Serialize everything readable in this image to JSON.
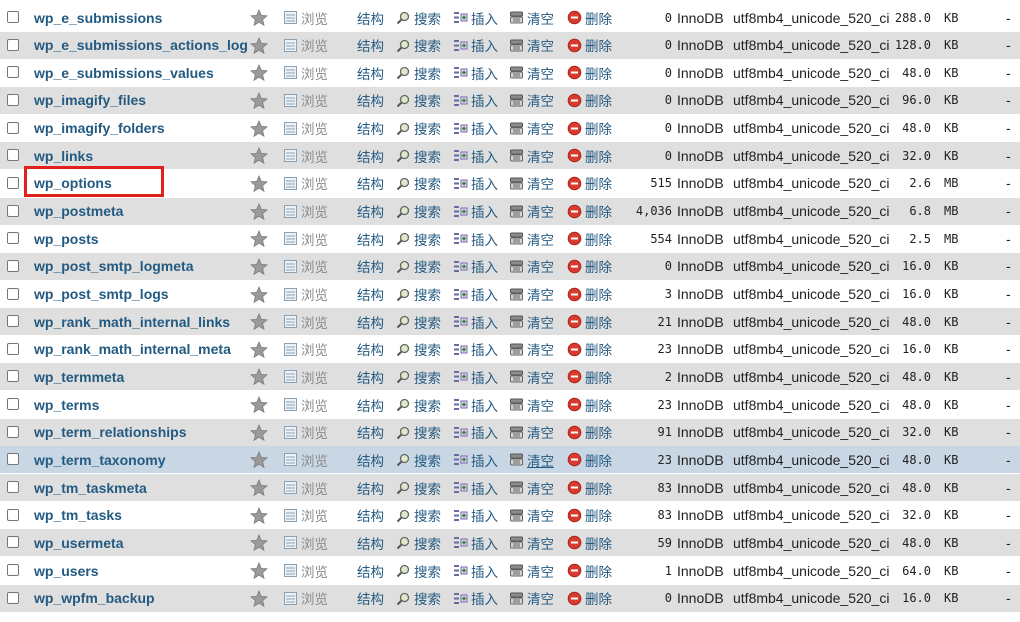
{
  "actions": {
    "browse": "浏览",
    "structure": "结构",
    "search": "搜索",
    "insert": "插入",
    "empty": "清空",
    "drop": "删除"
  },
  "icons": {
    "favorite": "star-icon",
    "browse": "browse-icon",
    "search": "search-icon",
    "insert": "insert-icon",
    "empty": "empty-icon",
    "drop": "drop-icon"
  },
  "colors": {
    "link": "#235a81",
    "row_alt": "#dfdfdf",
    "row_hover": "#c9d6e3",
    "highlight": "#e0201b",
    "star": "#9a9a9a",
    "drop": "#d83b2d"
  },
  "highlighted_table": "wp_options",
  "hovered_table": "wp_term_taxonomy",
  "tables": [
    {
      "name": "wp_e_submissions",
      "rows": "0",
      "engine": "InnoDB",
      "collation": "utf8mb4_unicode_520_ci",
      "size": "288.0",
      "unit": "KB",
      "overhead": "-"
    },
    {
      "name": "wp_e_submissions_actions_log",
      "rows": "0",
      "engine": "InnoDB",
      "collation": "utf8mb4_unicode_520_ci",
      "size": "128.0",
      "unit": "KB",
      "overhead": "-"
    },
    {
      "name": "wp_e_submissions_values",
      "rows": "0",
      "engine": "InnoDB",
      "collation": "utf8mb4_unicode_520_ci",
      "size": "48.0",
      "unit": "KB",
      "overhead": "-"
    },
    {
      "name": "wp_imagify_files",
      "rows": "0",
      "engine": "InnoDB",
      "collation": "utf8mb4_unicode_520_ci",
      "size": "96.0",
      "unit": "KB",
      "overhead": "-"
    },
    {
      "name": "wp_imagify_folders",
      "rows": "0",
      "engine": "InnoDB",
      "collation": "utf8mb4_unicode_520_ci",
      "size": "48.0",
      "unit": "KB",
      "overhead": "-"
    },
    {
      "name": "wp_links",
      "rows": "0",
      "engine": "InnoDB",
      "collation": "utf8mb4_unicode_520_ci",
      "size": "32.0",
      "unit": "KB",
      "overhead": "-"
    },
    {
      "name": "wp_options",
      "rows": "515",
      "engine": "InnoDB",
      "collation": "utf8mb4_unicode_520_ci",
      "size": "2.6",
      "unit": "MB",
      "overhead": "-"
    },
    {
      "name": "wp_postmeta",
      "rows": "4,036",
      "engine": "InnoDB",
      "collation": "utf8mb4_unicode_520_ci",
      "size": "6.8",
      "unit": "MB",
      "overhead": "-"
    },
    {
      "name": "wp_posts",
      "rows": "554",
      "engine": "InnoDB",
      "collation": "utf8mb4_unicode_520_ci",
      "size": "2.5",
      "unit": "MB",
      "overhead": "-"
    },
    {
      "name": "wp_post_smtp_logmeta",
      "rows": "0",
      "engine": "InnoDB",
      "collation": "utf8mb4_unicode_520_ci",
      "size": "16.0",
      "unit": "KB",
      "overhead": "-"
    },
    {
      "name": "wp_post_smtp_logs",
      "rows": "3",
      "engine": "InnoDB",
      "collation": "utf8mb4_unicode_520_ci",
      "size": "16.0",
      "unit": "KB",
      "overhead": "-"
    },
    {
      "name": "wp_rank_math_internal_links",
      "rows": "21",
      "engine": "InnoDB",
      "collation": "utf8mb4_unicode_520_ci",
      "size": "48.0",
      "unit": "KB",
      "overhead": "-"
    },
    {
      "name": "wp_rank_math_internal_meta",
      "rows": "23",
      "engine": "InnoDB",
      "collation": "utf8mb4_unicode_520_ci",
      "size": "16.0",
      "unit": "KB",
      "overhead": "-"
    },
    {
      "name": "wp_termmeta",
      "rows": "2",
      "engine": "InnoDB",
      "collation": "utf8mb4_unicode_520_ci",
      "size": "48.0",
      "unit": "KB",
      "overhead": "-"
    },
    {
      "name": "wp_terms",
      "rows": "23",
      "engine": "InnoDB",
      "collation": "utf8mb4_unicode_520_ci",
      "size": "48.0",
      "unit": "KB",
      "overhead": "-"
    },
    {
      "name": "wp_term_relationships",
      "rows": "91",
      "engine": "InnoDB",
      "collation": "utf8mb4_unicode_520_ci",
      "size": "32.0",
      "unit": "KB",
      "overhead": "-"
    },
    {
      "name": "wp_term_taxonomy",
      "rows": "23",
      "engine": "InnoDB",
      "collation": "utf8mb4_unicode_520_ci",
      "size": "48.0",
      "unit": "KB",
      "overhead": "-"
    },
    {
      "name": "wp_tm_taskmeta",
      "rows": "83",
      "engine": "InnoDB",
      "collation": "utf8mb4_unicode_520_ci",
      "size": "48.0",
      "unit": "KB",
      "overhead": "-"
    },
    {
      "name": "wp_tm_tasks",
      "rows": "83",
      "engine": "InnoDB",
      "collation": "utf8mb4_unicode_520_ci",
      "size": "32.0",
      "unit": "KB",
      "overhead": "-"
    },
    {
      "name": "wp_usermeta",
      "rows": "59",
      "engine": "InnoDB",
      "collation": "utf8mb4_unicode_520_ci",
      "size": "48.0",
      "unit": "KB",
      "overhead": "-"
    },
    {
      "name": "wp_users",
      "rows": "1",
      "engine": "InnoDB",
      "collation": "utf8mb4_unicode_520_ci",
      "size": "64.0",
      "unit": "KB",
      "overhead": "-"
    },
    {
      "name": "wp_wpfm_backup",
      "rows": "0",
      "engine": "InnoDB",
      "collation": "utf8mb4_unicode_520_ci",
      "size": "16.0",
      "unit": "KB",
      "overhead": "-"
    }
  ]
}
